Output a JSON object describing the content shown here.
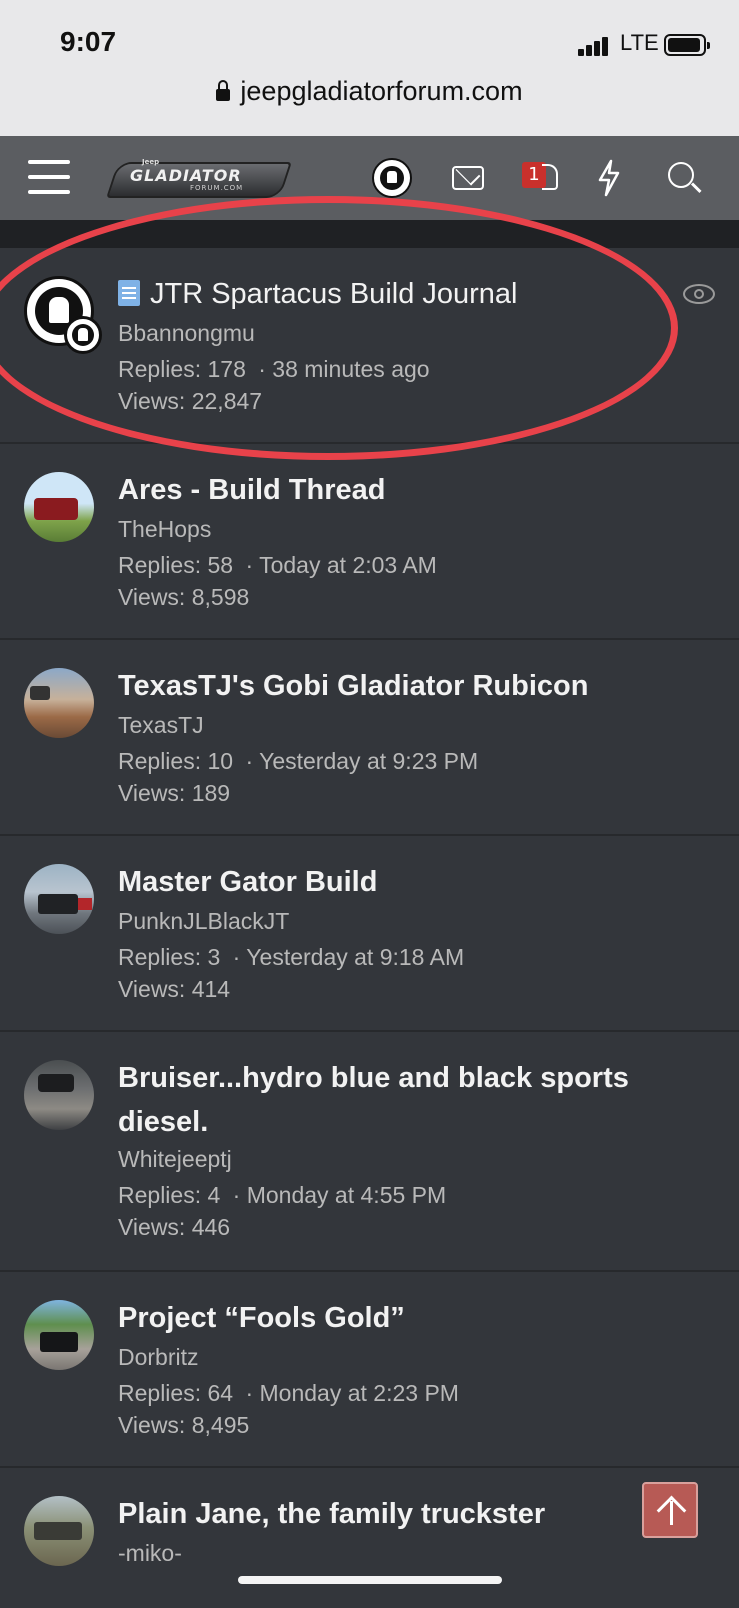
{
  "status_bar": {
    "time": "9:07",
    "network": "LTE"
  },
  "browser": {
    "url": "jeepgladiatorforum.com"
  },
  "header": {
    "logo_small": "Jeep",
    "logo_main": "GLADIATOR",
    "logo_sub": "FORUM.COM",
    "alerts_count": "1"
  },
  "threads": [
    {
      "title": "JTR Spartacus Build Journal",
      "author": "Bbannongmu",
      "replies": "Replies: 178",
      "time": "· 38 minutes ago",
      "views": "Views: 22,847"
    },
    {
      "title": "Ares - Build Thread",
      "author": "TheHops",
      "replies": "Replies: 58",
      "time": "· Today at 2:03 AM",
      "views": "Views: 8,598"
    },
    {
      "title": "TexasTJ's Gobi Gladiator Rubicon",
      "author": "TexasTJ",
      "replies": "Replies: 10",
      "time": "· Yesterday at 9:23 PM",
      "views": "Views: 189"
    },
    {
      "title": "Master Gator Build",
      "author": "PunknJLBlackJT",
      "replies": "Replies: 3",
      "time": "· Yesterday at 9:18 AM",
      "views": "Views: 414"
    },
    {
      "title": "Bruiser...hydro blue and black sports diesel.",
      "author": "Whitejeeptj",
      "replies": "Replies: 4",
      "time": "· Monday at 4:55 PM",
      "views": "Views: 446"
    },
    {
      "title": "Project “Fools Gold”",
      "author": "Dorbritz",
      "replies": "Replies: 64",
      "time": "· Monday at 2:23 PM",
      "views": "Views: 8,495"
    },
    {
      "title": "Plain Jane, the family truckster",
      "author": "-miko-",
      "replies": "",
      "time": "",
      "views": ""
    }
  ],
  "colors": {
    "background": "#33363b",
    "header": "#5b5d61",
    "highlight": "#e8424a",
    "badge": "#c9302c"
  }
}
